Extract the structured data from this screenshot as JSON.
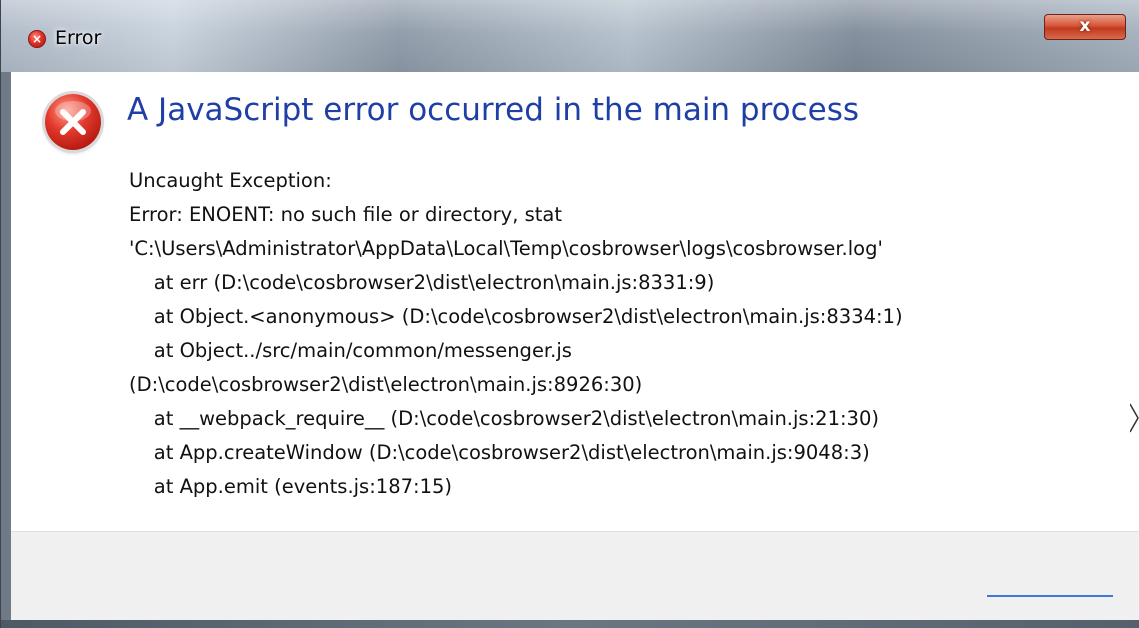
{
  "window": {
    "title": "Error",
    "close_label": "x"
  },
  "dialog": {
    "icon": "error-icon",
    "heading": "A JavaScript error occurred in the main process",
    "lines": [
      "Uncaught Exception:",
      "Error: ENOENT: no such file or directory, stat",
      "'C:\\Users\\Administrator\\AppData\\Local\\Temp\\cosbrowser\\logs\\cosbrowser.log'",
      "    at err (D:\\code\\cosbrowser2\\dist\\electron\\main.js:8331:9)",
      "    at Object.<anonymous> (D:\\code\\cosbrowser2\\dist\\electron\\main.js:8334:1)",
      "    at Object../src/main/common/messenger.js",
      "(D:\\code\\cosbrowser2\\dist\\electron\\main.js:8926:30)",
      "    at __webpack_require__ (D:\\code\\cosbrowser2\\dist\\electron\\main.js:21:30)",
      "    at App.createWindow (D:\\code\\cosbrowser2\\dist\\electron\\main.js:9048:3)",
      "    at App.emit (events.js:187:15)"
    ]
  },
  "colors": {
    "heading": "#1f3fa6",
    "close_button": "#c23a1f",
    "footer": "#f0f0f0",
    "link": "#3a7bd5"
  }
}
